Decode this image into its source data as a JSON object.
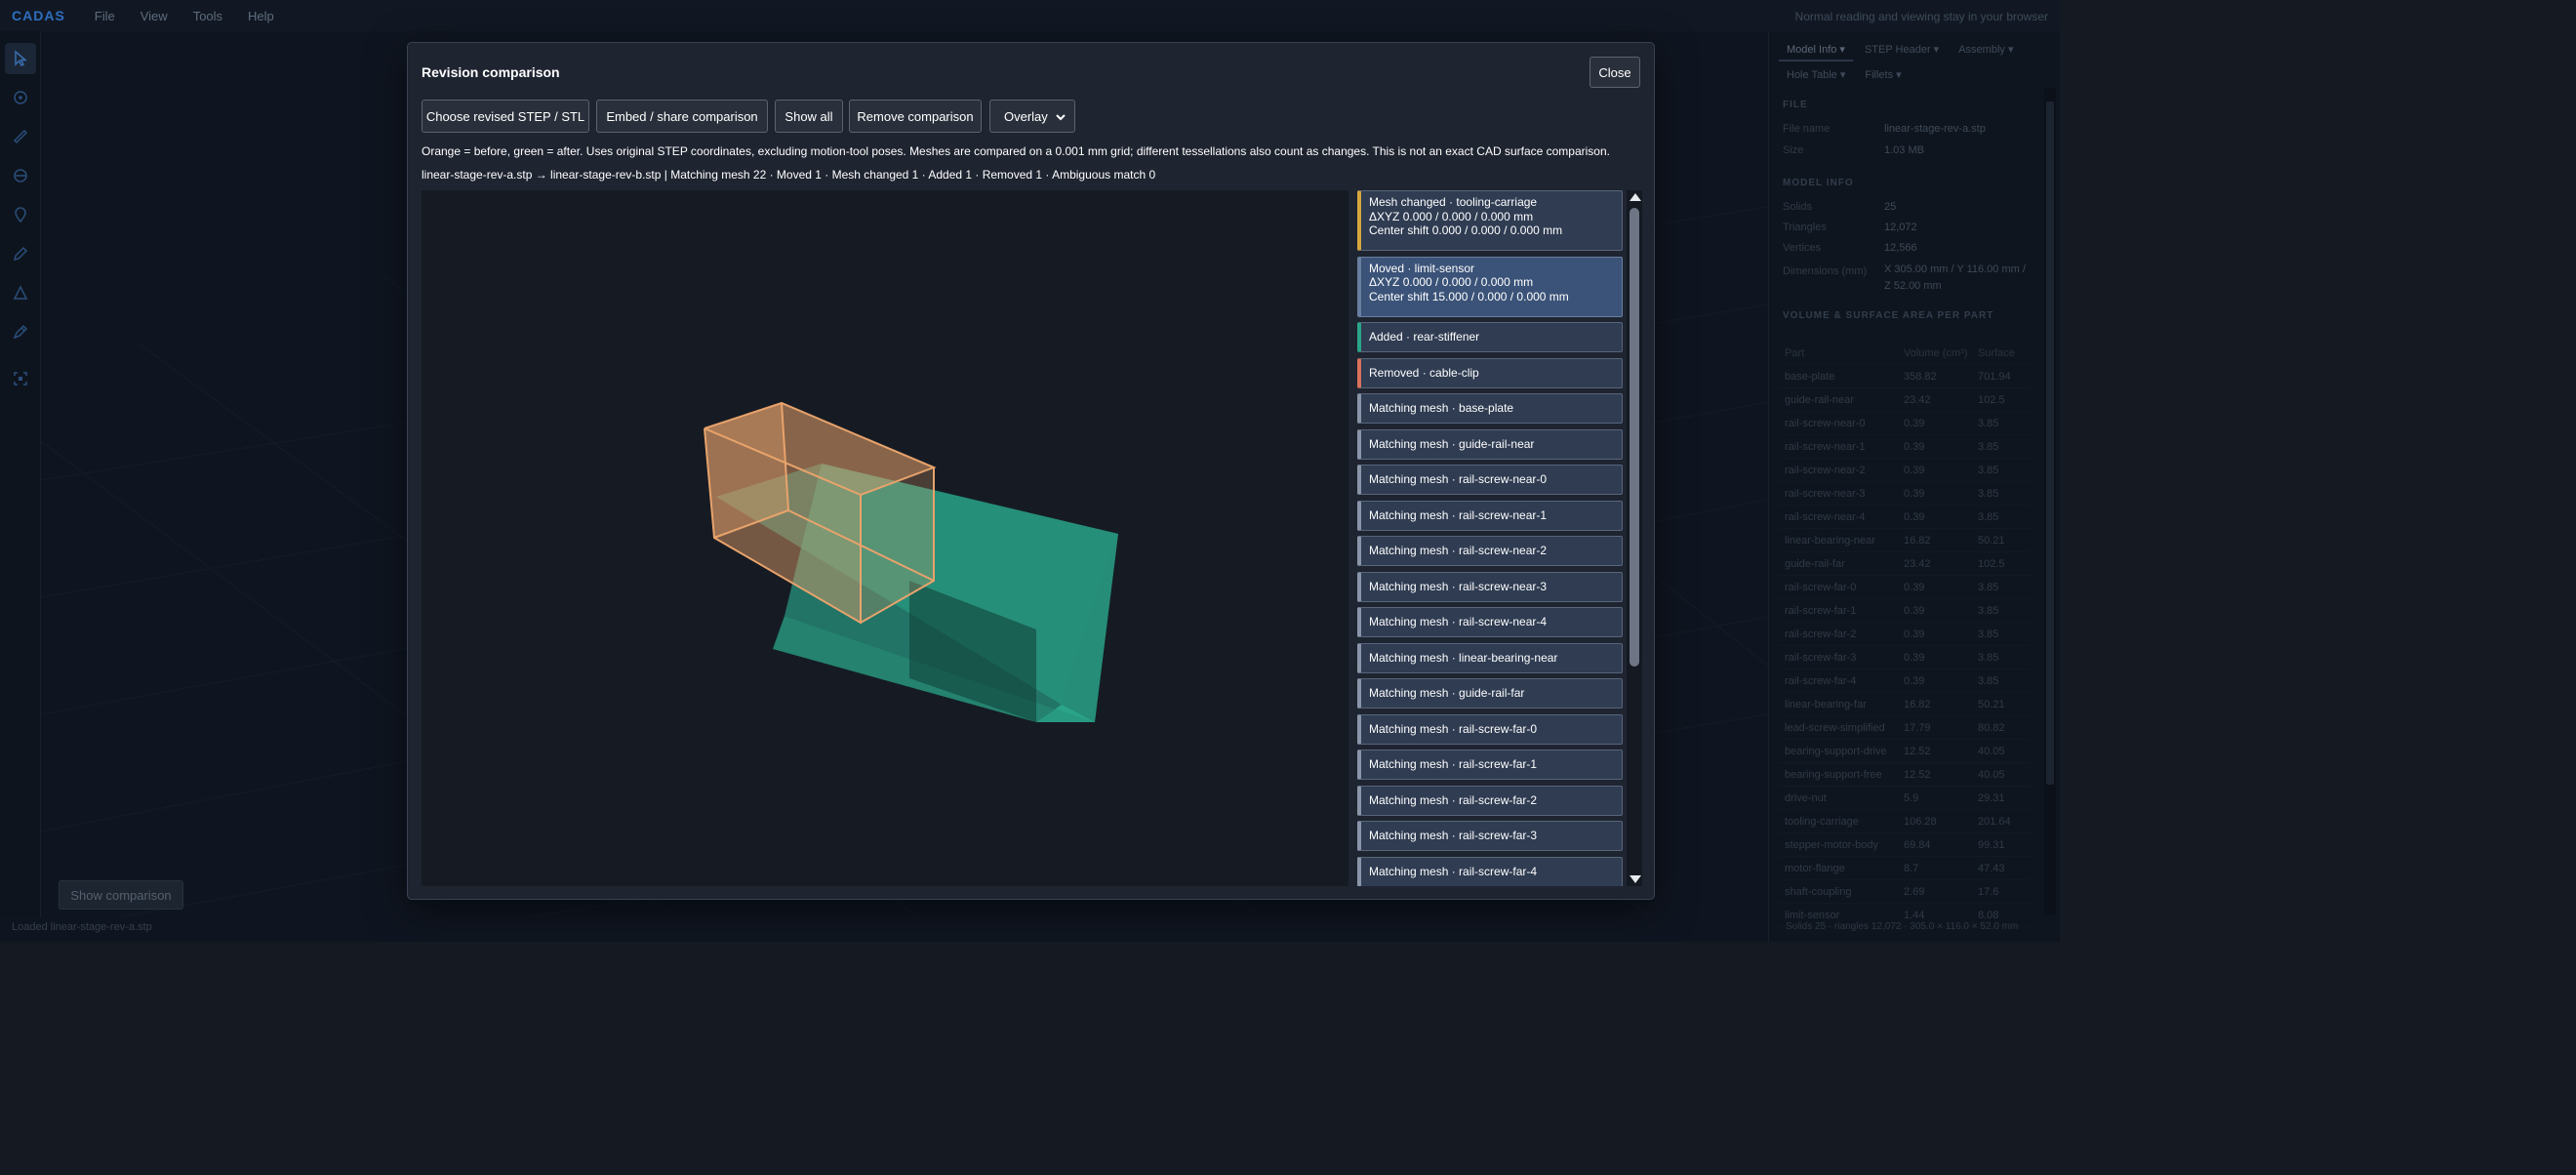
{
  "app": {
    "logo": "CADAS",
    "menu": [
      "File",
      "View",
      "Tools",
      "Help"
    ],
    "top_hint": "Normal reading and viewing stay in your browser",
    "show_comparison_label": "Show comparison",
    "status_left": "Loaded linear-stage-rev-a.stp",
    "status_right": "Solids 25 · riangles 12,072 · 305.0 × 116.0 × 52.0 mm"
  },
  "right_panel": {
    "tabs_row1": [
      "Model Info",
      "STEP Header",
      "Assembly"
    ],
    "tabs_row2": [
      "Hole Table",
      "Fillets"
    ],
    "file_section": "FILE",
    "file_name_label": "File name",
    "file_name_value": "linear-stage-rev-a.stp",
    "size_label": "Size",
    "size_value": "1.03 MB",
    "model_section": "MODEL INFO",
    "solids_label": "Solids",
    "solids_value": "25",
    "triangles_label": "Triangles",
    "triangles_value": "12,072",
    "vertices_label": "Vertices",
    "vertices_value": "12,566",
    "dimensions_label": "Dimensions (mm)",
    "dimensions_value": "X 305.00 mm / Y 116.00 mm / Z 52.00 mm",
    "volume_section": "VOLUME & SURFACE AREA PER PART",
    "table_headers": [
      "Part",
      "Volume (cm³)",
      "Surface"
    ],
    "table_rows": [
      [
        "base-plate",
        "358.82",
        "701.94"
      ],
      [
        "guide-rail-near",
        "23.42",
        "102.5"
      ],
      [
        "rail-screw-near-0",
        "0.39",
        "3.85"
      ],
      [
        "rail-screw-near-1",
        "0.39",
        "3.85"
      ],
      [
        "rail-screw-near-2",
        "0.39",
        "3.85"
      ],
      [
        "rail-screw-near-3",
        "0.39",
        "3.85"
      ],
      [
        "rail-screw-near-4",
        "0.39",
        "3.85"
      ],
      [
        "linear-bearing-near",
        "16.82",
        "50.21"
      ],
      [
        "guide-rail-far",
        "23.42",
        "102.5"
      ],
      [
        "rail-screw-far-0",
        "0.39",
        "3.85"
      ],
      [
        "rail-screw-far-1",
        "0.39",
        "3.85"
      ],
      [
        "rail-screw-far-2",
        "0.39",
        "3.85"
      ],
      [
        "rail-screw-far-3",
        "0.39",
        "3.85"
      ],
      [
        "rail-screw-far-4",
        "0.39",
        "3.85"
      ],
      [
        "linear-bearing-far",
        "16.82",
        "50.21"
      ],
      [
        "lead-screw-simplified",
        "17.79",
        "80.82"
      ],
      [
        "bearing-support-drive",
        "12.52",
        "40.05"
      ],
      [
        "bearing-support-free",
        "12.52",
        "40.05"
      ],
      [
        "drive-nut",
        "5.9",
        "29.31"
      ],
      [
        "tooling-carriage",
        "106.28",
        "201.64"
      ],
      [
        "stepper-motor-body",
        "69.84",
        "99.31"
      ],
      [
        "motor-flange",
        "8.7",
        "47.43"
      ],
      [
        "shaft-coupling",
        "2.69",
        "17.6"
      ],
      [
        "limit-sensor",
        "1.44",
        "8.08"
      ]
    ]
  },
  "modal": {
    "title": "Revision comparison",
    "close_label": "Close",
    "choose_label": "Choose revised STEP / STL",
    "embed_label": "Embed / share comparison",
    "show_all_label": "Show all",
    "remove_label": "Remove comparison",
    "mode_value": "Overlay",
    "legend": "Orange = before, green = after. Uses original STEP coordinates, excluding motion-tool poses. Meshes are compared on a 0.001 mm grid; different tessellations also count as changes. This is not an exact CAD surface comparison.",
    "summary": "linear-stage-rev-a.stp → linear-stage-rev-b.stp | Matching mesh 22 · Moved 1 · Mesh changed 1 · Added 1 · Removed 1 · Ambiguous match 0",
    "colors": {
      "before": "#e8a36c",
      "after": "#2aa58a"
    },
    "changes": [
      {
        "kind": "changed",
        "lines": [
          "Mesh changed · tooling-carriage",
          "ΔXYZ 0.000 / 0.000 / 0.000 mm",
          "Center shift 0.000 / 0.000 / 0.000 mm"
        ]
      },
      {
        "kind": "moved",
        "lines": [
          "Moved · limit-sensor",
          "ΔXYZ 0.000 / 0.000 / 0.000 mm",
          "Center shift 15.000 / 0.000 / 0.000 mm"
        ]
      },
      {
        "kind": "added",
        "lines": [
          "Added · rear-stiffener"
        ]
      },
      {
        "kind": "removed",
        "lines": [
          "Removed · cable-clip"
        ]
      },
      {
        "kind": "match",
        "lines": [
          "Matching mesh · base-plate"
        ]
      },
      {
        "kind": "match",
        "lines": [
          "Matching mesh · guide-rail-near"
        ]
      },
      {
        "kind": "match",
        "lines": [
          "Matching mesh · rail-screw-near-0"
        ]
      },
      {
        "kind": "match",
        "lines": [
          "Matching mesh · rail-screw-near-1"
        ]
      },
      {
        "kind": "match",
        "lines": [
          "Matching mesh · rail-screw-near-2"
        ]
      },
      {
        "kind": "match",
        "lines": [
          "Matching mesh · rail-screw-near-3"
        ]
      },
      {
        "kind": "match",
        "lines": [
          "Matching mesh · rail-screw-near-4"
        ]
      },
      {
        "kind": "match",
        "lines": [
          "Matching mesh · linear-bearing-near"
        ]
      },
      {
        "kind": "match",
        "lines": [
          "Matching mesh · guide-rail-far"
        ]
      },
      {
        "kind": "match",
        "lines": [
          "Matching mesh · rail-screw-far-0"
        ]
      },
      {
        "kind": "match",
        "lines": [
          "Matching mesh · rail-screw-far-1"
        ]
      },
      {
        "kind": "match",
        "lines": [
          "Matching mesh · rail-screw-far-2"
        ]
      },
      {
        "kind": "match",
        "lines": [
          "Matching mesh · rail-screw-far-3"
        ]
      },
      {
        "kind": "match",
        "lines": [
          "Matching mesh · rail-screw-far-4"
        ]
      }
    ]
  }
}
